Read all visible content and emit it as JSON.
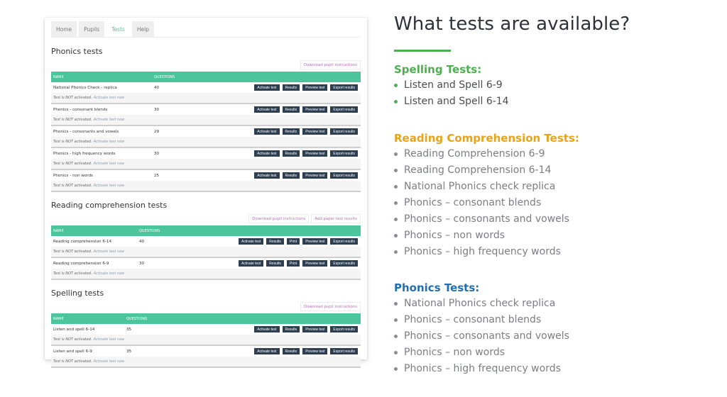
{
  "app": {
    "tabs": [
      {
        "label": "Home",
        "active": false
      },
      {
        "label": "Pupils",
        "active": false
      },
      {
        "label": "Tests",
        "active": true
      },
      {
        "label": "Help",
        "active": false
      }
    ],
    "columns": {
      "name": "NAME",
      "questions": "QUESTIONS"
    },
    "status_text": "Test is NOT activated.",
    "activate_link": "Activate test now",
    "buttons": {
      "activate": "Activate test",
      "results": "Results",
      "print": "Print",
      "preview": "Preview test",
      "export": "Export results"
    },
    "sections": {
      "phonics": {
        "title": "Phonics tests",
        "actions": [
          "Download pupil instructions"
        ],
        "rows": [
          {
            "name": "National Phonics Check - replica",
            "questions": "40"
          },
          {
            "name": "Phonics - consonant blends",
            "questions": "30"
          },
          {
            "name": "Phonics - consonants and vowels",
            "questions": "29"
          },
          {
            "name": "Phonics - high frequency words",
            "questions": "30"
          },
          {
            "name": "Phonics - non words",
            "questions": "25"
          }
        ]
      },
      "reading": {
        "title": "Reading comprehension tests",
        "actions": [
          "Download pupil instructions",
          "Add paper test results"
        ],
        "rows": [
          {
            "name": "Reading comprehension 6-14",
            "questions": "40"
          },
          {
            "name": "Reading comprehension 6-9",
            "questions": "30"
          }
        ]
      },
      "spelling": {
        "title": "Spelling tests",
        "actions": [
          "Download pupil instructions"
        ],
        "rows": [
          {
            "name": "Listen and spell 6-14",
            "questions": "35"
          },
          {
            "name": "Listen and spell 6-9",
            "questions": "35"
          }
        ]
      }
    }
  },
  "info": {
    "heading": "What tests are available?",
    "accent_rule_color": "#4fae52",
    "groups": {
      "spelling": {
        "title": "Spelling Tests:",
        "color": "#4fae52",
        "items": [
          "Listen and Spell 6-9",
          "Listen and Spell 6-14"
        ]
      },
      "reading": {
        "title": "Reading Comprehension Tests:",
        "color": "#e8a317",
        "items": [
          "Reading Comprehension 6-9",
          "Reading Comprehension 6-14",
          "National Phonics check replica",
          "Phonics – consonant blends",
          "Phonics – consonants and vowels",
          "Phonics – non words",
          "Phonics – high frequency words"
        ]
      },
      "phonics": {
        "title": "Phonics Tests:",
        "color": "#1f6fb2",
        "items": [
          "National Phonics check replica",
          "Phonics – consonant blends",
          "Phonics – consonants and vowels",
          "Phonics – non words",
          "Phonics – high frequency words"
        ]
      }
    }
  }
}
